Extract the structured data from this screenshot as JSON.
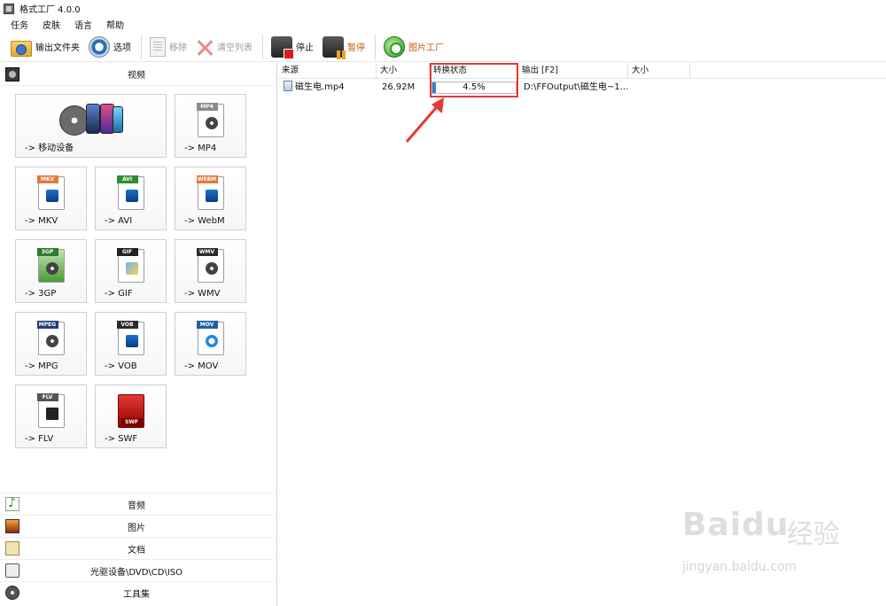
{
  "window": {
    "title": "格式工厂 4.0.0"
  },
  "menu": [
    "任务",
    "皮肤",
    "语言",
    "帮助"
  ],
  "toolbar": {
    "output_folder": "输出文件夹",
    "options": "选项",
    "remove": "移除",
    "clear_list": "清空列表",
    "stop": "停止",
    "pause": "暂停",
    "picture_factory": "图片工厂"
  },
  "left_panel": {
    "video_header": "视频",
    "tiles": [
      "-> 移动设备",
      "-> MP4",
      "-> MKV",
      "-> AVI",
      "-> WebM",
      "-> 3GP",
      "-> GIF",
      "-> WMV",
      "-> MPG",
      "-> VOB",
      "-> MOV",
      "-> FLV",
      "-> SWF"
    ],
    "tile_badges": [
      "MP4",
      "MKV",
      "AVI",
      "WEBM",
      "3GP",
      "GIF",
      "WMV",
      "MPEG",
      "VOB",
      "MOV",
      "FLV",
      "SWF"
    ],
    "categories": [
      "音频",
      "图片",
      "文档",
      "光驱设备\\DVD\\CD\\ISO",
      "工具集"
    ]
  },
  "file_list": {
    "columns": [
      "来源",
      "大小",
      "转换状态",
      "输出 [F2]",
      "大小"
    ],
    "rows": [
      {
        "source": "磁生电.mp4",
        "size": "26.92M",
        "status": "4.5%",
        "progress": 0.045,
        "output": "D:\\FFOutput\\磁生电~1...",
        "out_size": ""
      }
    ]
  },
  "watermark": {
    "brand": "Baidu",
    "cn": "经验",
    "url": "jingyan.baidu.com"
  },
  "colors": {
    "highlight": "#e53935",
    "progress": "#3a7bd5",
    "accent_label": "#c25b00"
  }
}
